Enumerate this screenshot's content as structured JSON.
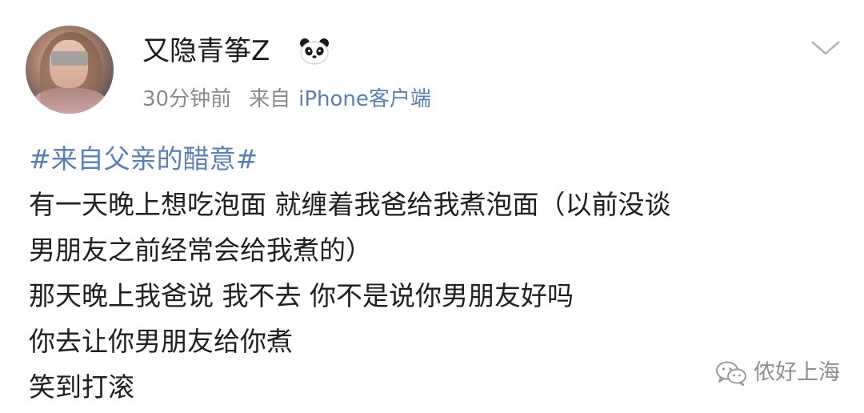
{
  "post": {
    "author": {
      "name": "又隐青筝Z",
      "badge_icon": "panda-icon",
      "avatar_icon": "avatar"
    },
    "meta": {
      "time": "30分钟前",
      "source_prefix": "来自",
      "source": "iPhone客户端"
    },
    "menu_icon": "chevron-down-icon",
    "hashtag": "#来自父亲的醋意#",
    "lines": [
      "有一天晚上想吃泡面 就缠着我爸给我煮泡面（以前没谈",
      "男朋友之前经常会给我煮的）",
      "那天晚上我爸说 我不去 你不是说你男朋友好吗",
      "你去让你男朋友给你煮",
      "笑到打滚"
    ]
  },
  "watermark": {
    "icon": "wechat-icon",
    "text": "侬好上海"
  },
  "colors": {
    "link": "#5b7fb0",
    "meta": "#8a8a8a",
    "text": "#1f1f1f"
  }
}
